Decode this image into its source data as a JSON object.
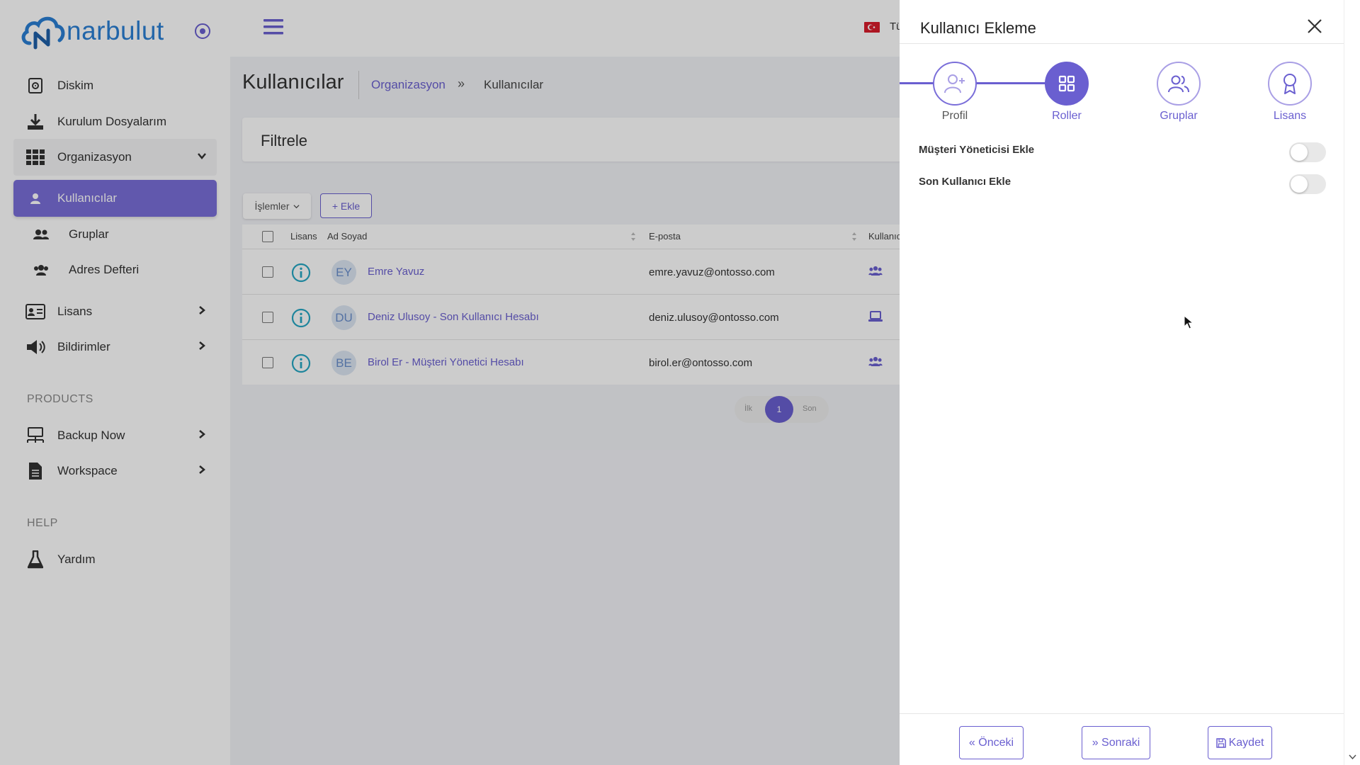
{
  "brand": {
    "logo_text": "narbulut"
  },
  "sidebar": {
    "items": [
      {
        "label": "Diskim",
        "icon": "hdd-icon"
      },
      {
        "label": "Kurulum Dosyalarım",
        "icon": "download-icon"
      },
      {
        "label": "Organizasyon",
        "icon": "grid-icon"
      },
      {
        "label": "Kullanıcılar",
        "icon": "user-icon"
      },
      {
        "label": "Gruplar",
        "icon": "users-icon"
      },
      {
        "label": "Adres Defteri",
        "icon": "address-book-icon"
      },
      {
        "label": "Lisans",
        "icon": "id-card-icon"
      },
      {
        "label": "Bildirimler",
        "icon": "megaphone-icon"
      },
      {
        "label": "Backup Now",
        "icon": "network-icon"
      },
      {
        "label": "Workspace",
        "icon": "document-icon"
      },
      {
        "label": "Yardım",
        "icon": "flask-icon"
      }
    ],
    "sections": {
      "products": "PRODUCTS",
      "help": "HELP"
    }
  },
  "topbar": {
    "language": "Tü"
  },
  "page": {
    "title": "Kullanıcılar",
    "breadcrumb": [
      "Organizasyon",
      "»",
      "Kullanıcılar"
    ],
    "filter_title": "Filtrele"
  },
  "toolbar": {
    "actions_label": "İşlemler",
    "add_label": "+ Ekle"
  },
  "table": {
    "columns": [
      "Lisans",
      "Ad Soyad",
      "E-posta",
      "Kullanıcı"
    ],
    "rows": [
      {
        "initials": "EY",
        "name": "Emre Yavuz",
        "email": "emre.yavuz@ontosso.com",
        "type_icon": "users-icon"
      },
      {
        "initials": "DU",
        "name": "Deniz Ulusoy - Son Kullanıcı Hesabı",
        "email": "deniz.ulusoy@ontosso.com",
        "type_icon": "laptop-icon"
      },
      {
        "initials": "BE",
        "name": "Birol Er - Müşteri Yönetici Hesabı",
        "email": "birol.er@ontosso.com",
        "type_icon": "users-icon"
      }
    ]
  },
  "pagination": {
    "first": "İlk",
    "current": "1",
    "last": "Son"
  },
  "drawer": {
    "title": "Kullanıcı Ekleme",
    "steps": [
      {
        "label": "Profil",
        "state": "done"
      },
      {
        "label": "Roller",
        "state": "active"
      },
      {
        "label": "Gruplar",
        "state": "pending"
      },
      {
        "label": "Lisans",
        "state": "pending"
      }
    ],
    "toggles": [
      {
        "label": "Müşteri Yöneticisi Ekle",
        "on": false
      },
      {
        "label": "Son Kullanıcı Ekle",
        "on": false
      }
    ],
    "buttons": {
      "prev": "« Önceki",
      "next": "» Sonraki",
      "save": "Kaydet"
    }
  },
  "colors": {
    "accent": "#6a5fd0",
    "active_nav": "#7a6ed9",
    "logo": "#2a7fd4",
    "teal": "#26a7c4"
  }
}
